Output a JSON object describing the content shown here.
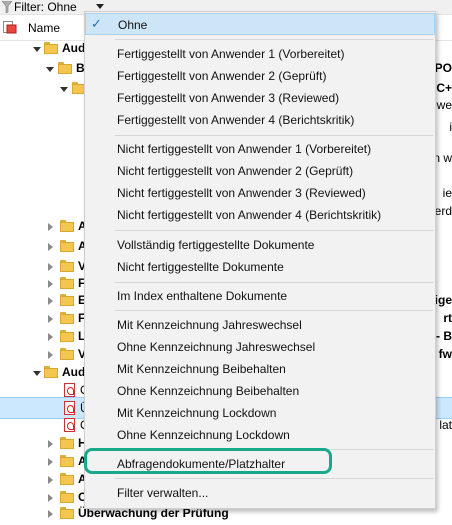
{
  "filterbar": {
    "label": "Filter: Ohne"
  },
  "header": {
    "name_col": "Name"
  },
  "tree": {
    "top_labels": [
      "Aud",
      "B",
      "",
      "A",
      "A",
      "V",
      "F",
      "E",
      "F",
      "L",
      "V",
      "Aud",
      "O",
      "Ü",
      "O",
      "H",
      "A",
      "A",
      "O"
    ],
    "right_texts": {
      "r1": "IPO",
      "r2": "C+",
      "r3": "we",
      "r4": "i",
      "r5": "n w",
      "r6": "ie",
      "r7": "erd",
      "r8": "ige",
      "r9": "rt",
      "r10": "- B",
      "r11": "fw",
      "r12": "lat"
    },
    "bottom_row": "Überwachung der Prüfung"
  },
  "menu": {
    "items": [
      {
        "label": "Ohne",
        "checked": true
      },
      {
        "label": "Fertiggestellt von Anwender 1 (Vorbereitet)"
      },
      {
        "label": "Fertiggestellt von Anwender 2 (Geprüft)"
      },
      {
        "label": "Fertiggestellt von Anwender 3 (Reviewed)"
      },
      {
        "label": "Fertiggestellt von Anwender 4 (Berichtskritik)"
      },
      {
        "label": "Nicht fertiggestellt von Anwender 1 (Vorbereitet)"
      },
      {
        "label": "Nicht fertiggestellt von Anwender 2 (Geprüft)"
      },
      {
        "label": "Nicht fertiggestellt von Anwender 3 (Reviewed)"
      },
      {
        "label": "Nicht fertiggestellt von Anwender 4 (Berichtskritik)"
      },
      {
        "label": "Vollständig fertiggestellte Dokumente"
      },
      {
        "label": "Nicht fertiggestellte Dokumente"
      },
      {
        "label": "Im Index enthaltene Dokumente"
      },
      {
        "label": "Mit Kennzeichnung Jahreswechsel"
      },
      {
        "label": "Ohne Kennzeichnung Jahreswechsel"
      },
      {
        "label": "Mit Kennzeichnung Beibehalten"
      },
      {
        "label": "Ohne Kennzeichnung Beibehalten"
      },
      {
        "label": "Mit Kennzeichnung Lockdown"
      },
      {
        "label": "Ohne Kennzeichnung Lockdown"
      },
      {
        "label": "Abfragendokumente/Platzhalter"
      },
      {
        "label": "Filter verwalten..."
      }
    ]
  },
  "colors": {
    "accent_check": "#1f6fc9",
    "highlight_outline": "#1aa88a",
    "selected_row": "#cce8ff"
  }
}
